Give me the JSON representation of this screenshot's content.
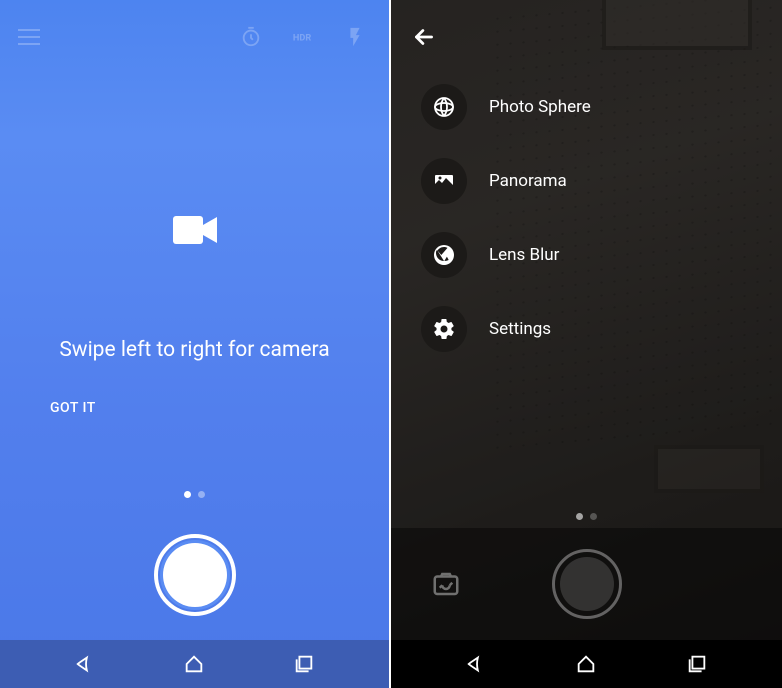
{
  "left": {
    "hint_text": "Swipe left to right for camera",
    "confirm_label": "GOT IT"
  },
  "right": {
    "menu": [
      {
        "label": "Photo Sphere"
      },
      {
        "label": "Panorama"
      },
      {
        "label": "Lens Blur"
      },
      {
        "label": "Settings"
      }
    ]
  }
}
